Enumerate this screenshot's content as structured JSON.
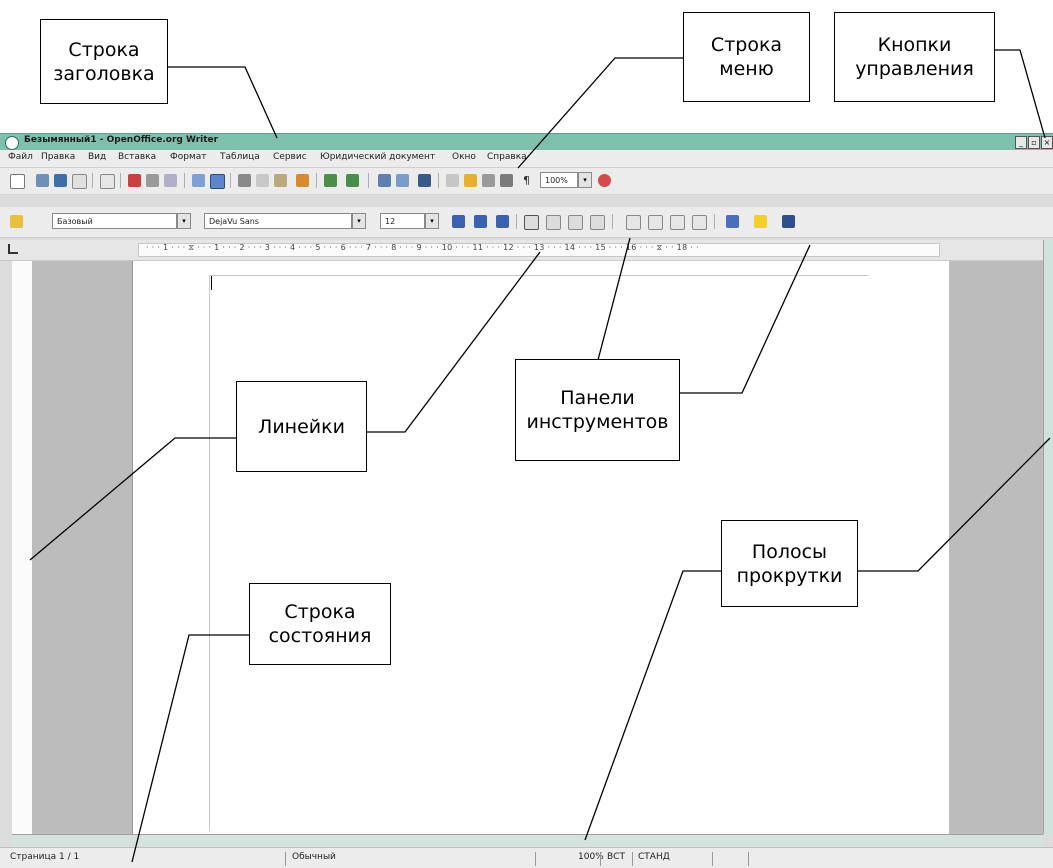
{
  "window": {
    "title": "Безымянный1 - OpenOffice.org Writer",
    "controls": [
      "_",
      "▫",
      "×"
    ]
  },
  "menu": [
    "Файл",
    "Правка",
    "Вид",
    "Вставка",
    "Формат",
    "Таблица",
    "Сервис",
    "Юридический документ",
    "Окно",
    "Справка"
  ],
  "toolbar_format": {
    "style": "Базовый",
    "font": "DejaVu Sans",
    "size": "12",
    "zoom": "100%"
  },
  "ruler": {
    "text": "· · · 1 · · · ⧖ · · · 1 · · · 2 · · · 3 · · · 4 · · · 5 · · · 6 · · · 7 · · · 8 · · · 9 · · · 10 · · · 11 · · · 12 · · · 13 · · · 14 · · · 15 · · · 16 · · · ⧖ · · 18 · ·"
  },
  "statusbar": {
    "page": "Страница  1 / 1",
    "style": "Обычный",
    "zoom": "100%",
    "insert": "ВСТ",
    "std": "СТАНД"
  },
  "callouts": {
    "title_bar": "Строка\nзаголовка",
    "menu_bar": "Строка\nменю",
    "control_buttons": "Кнопки\nуправления",
    "rulers": "Линейки",
    "toolbars": "Панели\nинструментов",
    "scrollbars": "Полосы\nпрокрутки",
    "status_bar": "Строка\nсостояния"
  }
}
